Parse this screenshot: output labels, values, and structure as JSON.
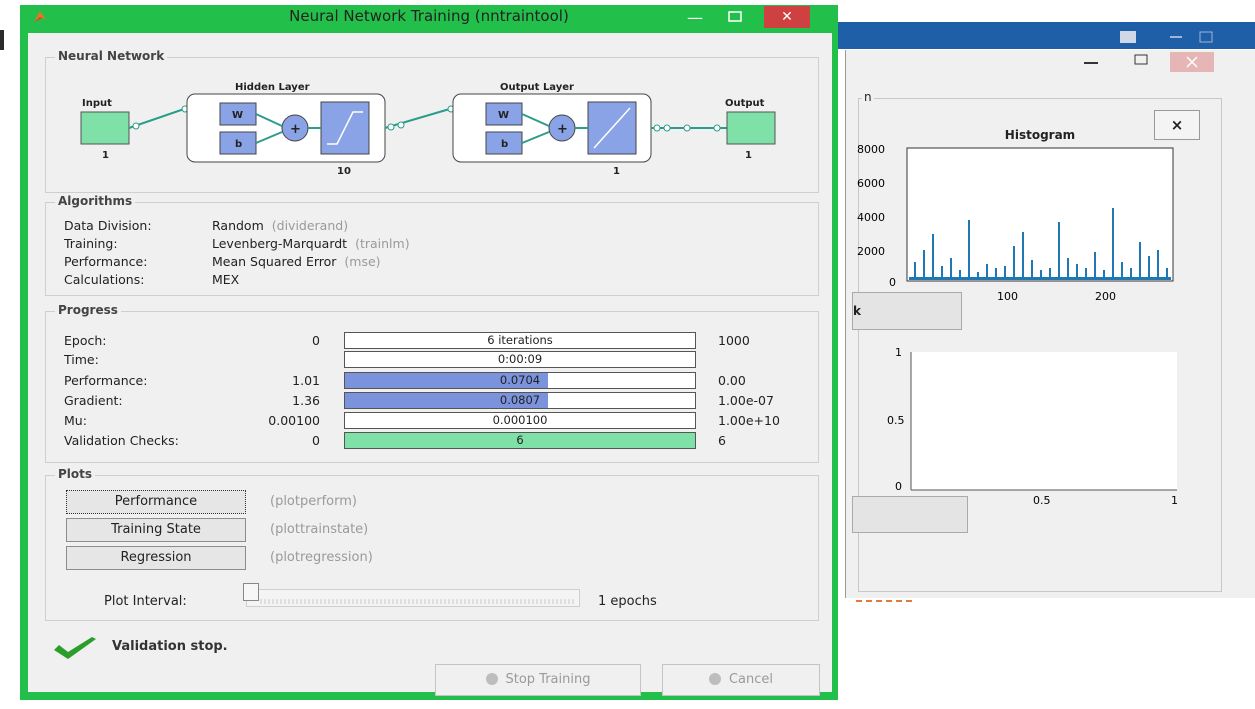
{
  "window": {
    "title": "Neural Network Training (nntraintool)",
    "min_glyph": "—",
    "close_glyph": "✕"
  },
  "neural_network": {
    "group_title": "Neural Network",
    "input_label": "Input",
    "input_size": "1",
    "hidden_layer_label": "Hidden Layer",
    "hidden_size": "10",
    "output_layer_label": "Output Layer",
    "output_layer_size": "1",
    "output_label": "Output",
    "output_size": "1",
    "weight_label": "W",
    "bias_label": "b",
    "plus_label": "+"
  },
  "algorithms": {
    "group_title": "Algorithms",
    "rows": [
      {
        "label": "Data Division:",
        "value": "Random",
        "fn": "(dividerand)"
      },
      {
        "label": "Training:",
        "value": "Levenberg-Marquardt",
        "fn": "(trainlm)"
      },
      {
        "label": "Performance:",
        "value": "Mean Squared Error",
        "fn": "(mse)"
      },
      {
        "label": "Calculations:",
        "value": "MEX",
        "fn": ""
      }
    ]
  },
  "progress": {
    "group_title": "Progress",
    "rows": [
      {
        "label": "Epoch:",
        "start": "0",
        "current": "6 iterations",
        "end": "1000",
        "fill": 0.0,
        "color": "#ffffff"
      },
      {
        "label": "Time:",
        "start": "",
        "current": "0:00:09",
        "end": "",
        "fill": 0.0,
        "color": "#ffffff"
      },
      {
        "label": "Performance:",
        "start": "1.01",
        "current": "0.0704",
        "end": "0.00",
        "fill": 0.58,
        "color": "#7b93dd"
      },
      {
        "label": "Gradient:",
        "start": "1.36",
        "current": "0.0807",
        "end": "1.00e-07",
        "fill": 0.58,
        "color": "#7b93dd"
      },
      {
        "label": "Mu:",
        "start": "0.00100",
        "current": "0.000100",
        "end": "1.00e+10",
        "fill": 0.0,
        "color": "#ffffff"
      },
      {
        "label": "Validation Checks:",
        "start": "0",
        "current": "6",
        "end": "6",
        "fill": 1.0,
        "color": "#7fe0a8"
      }
    ]
  },
  "plots": {
    "group_title": "Plots",
    "buttons": [
      {
        "label": "Performance",
        "fn": "(plotperform)"
      },
      {
        "label": "Training State",
        "fn": "(plottrainstate)"
      },
      {
        "label": "Regression",
        "fn": "(plotregression)"
      }
    ],
    "interval_label": "Plot Interval:",
    "interval_value": "1 epochs",
    "interval_fraction": 0.0
  },
  "status": {
    "text": "Validation stop.",
    "check_color": "#2a9d2a"
  },
  "footer": {
    "stop_label": "Stop Training",
    "cancel_label": "Cancel"
  },
  "background_window": {
    "panel_title_fragment": "n",
    "close_button": "×",
    "button_fragment": "k",
    "histogram": {
      "title": "Histogram",
      "y_ticks": [
        "8000",
        "6000",
        "4000",
        "2000",
        "0"
      ],
      "x_ticks": [
        "100",
        "200"
      ]
    },
    "scatter": {
      "y_ticks": [
        "1",
        "0.5",
        "0"
      ],
      "x_ticks": [
        "0.5",
        "1"
      ]
    }
  },
  "colors": {
    "window_border": "#22c04a",
    "layer_fill": "#8aa3e6",
    "io_fill": "#7fe0a8",
    "bar_blue": "#7b93dd",
    "bar_green": "#7fe0a8",
    "title_close": "#cf4040",
    "histogram_bars": "#1f77b4"
  }
}
